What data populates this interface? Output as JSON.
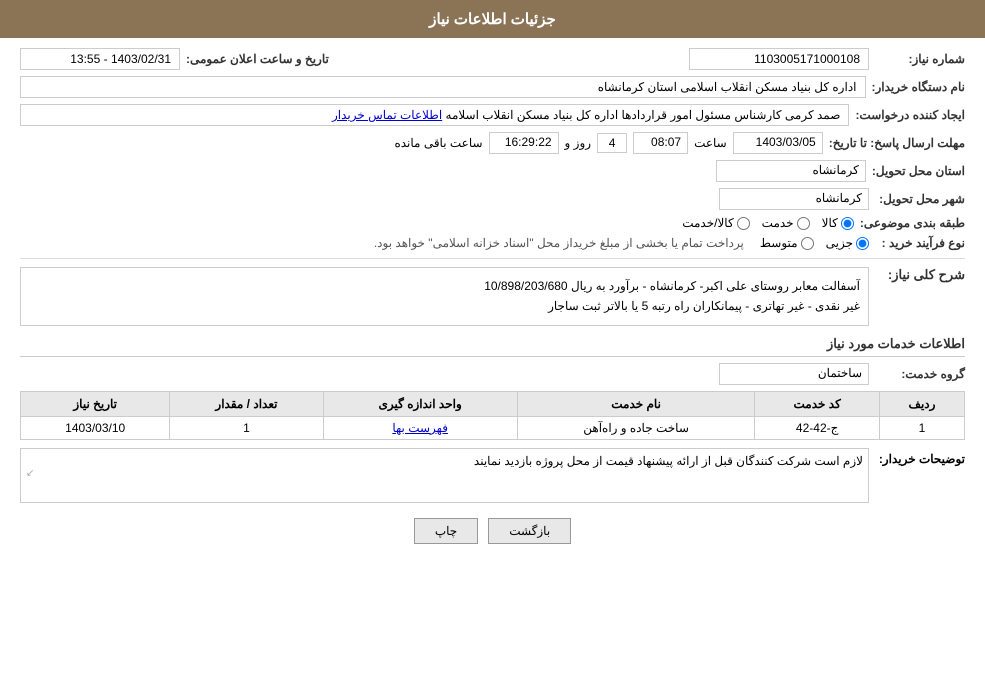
{
  "header": {
    "title": "جزئیات اطلاعات نیاز"
  },
  "fields": {
    "shomareNiaz_label": "شماره نیاز:",
    "shomareNiaz_value": "1103005171000108",
    "namDastgah_label": "نام دستگاه خریدار:",
    "namDastgah_value": "اداره کل بنیاد مسکن انقلاب اسلامی استان کرمانشاه",
    "ejad_label": "ایجاد کننده درخواست:",
    "ejad_value": "صمد کرمی کارشناس مسئول امور قراردادها اداره کل بنیاد مسکن انقلاب اسلامه",
    "ejad_link": "اطلاعات تماس خریدار",
    "mohlat_label": "مهلت ارسال پاسخ: تا تاریخ:",
    "date_value": "1403/03/05",
    "time_label": "ساعت",
    "time_value": "08:07",
    "days_label": "روز و",
    "days_value": "4",
    "countdown_label": "ساعت باقی مانده",
    "countdown_value": "16:29:22",
    "tarikh_elan_label": "تاریخ و ساعت اعلان عمومی:",
    "tarikh_elan_value": "1403/02/31 - 13:55",
    "ostan_label": "استان محل تحویل:",
    "ostan_value": "کرمانشاه",
    "shahr_label": "شهر محل تحویل:",
    "shahr_value": "کرمانشاه",
    "tabaqe_label": "طبقه بندی موضوعی:",
    "tabaqe_radio1": "کالا",
    "tabaqe_radio2": "خدمت",
    "tabaqe_radio3": "کالا/خدمت",
    "noeFarayand_label": "نوع فرآیند خرید :",
    "noeFarayand_radio1": "جزیی",
    "noeFarayand_radio2": "متوسط",
    "noeFarayand_note": "پرداخت تمام یا بخشی از مبلغ خریداز محل \"اسناد خزانه اسلامی\" خواهد بود.",
    "sharh_label": "شرح کلی نیاز:",
    "sharh_value": "آسفالت معابر روستای علی اکبر- کرمانشاه - برآورد به ریال 10/898/203/680\nغیر نقدی - غیر تهاتری - پیمانکاران راه رتبه 5 یا بالاتر ثبت ساجار",
    "khadamat_label": "اطلاعات خدمات مورد نیاز",
    "grohe_label": "گروه خدمت:",
    "grohe_value": "ساختمان",
    "table": {
      "columns": [
        "ردیف",
        "کد خدمت",
        "نام خدمت",
        "واحد اندازه گیری",
        "تعداد / مقدار",
        "تاریخ نیاز"
      ],
      "rows": [
        {
          "radif": "1",
          "kod": "ج-42-42",
          "name": "ساخت جاده و راه‌آهن",
          "vahed": "فهرست بها",
          "tedad": "1",
          "tarikh": "1403/03/10"
        }
      ]
    },
    "tozihat_label": "توضیحات خریدار:",
    "tozihat_value": "لازم است شرکت کنندگان قبل از ارائه پیشنهاد قیمت از محل پروژه بازدید نمایند",
    "btn_back": "بازگشت",
    "btn_print": "چاپ"
  }
}
